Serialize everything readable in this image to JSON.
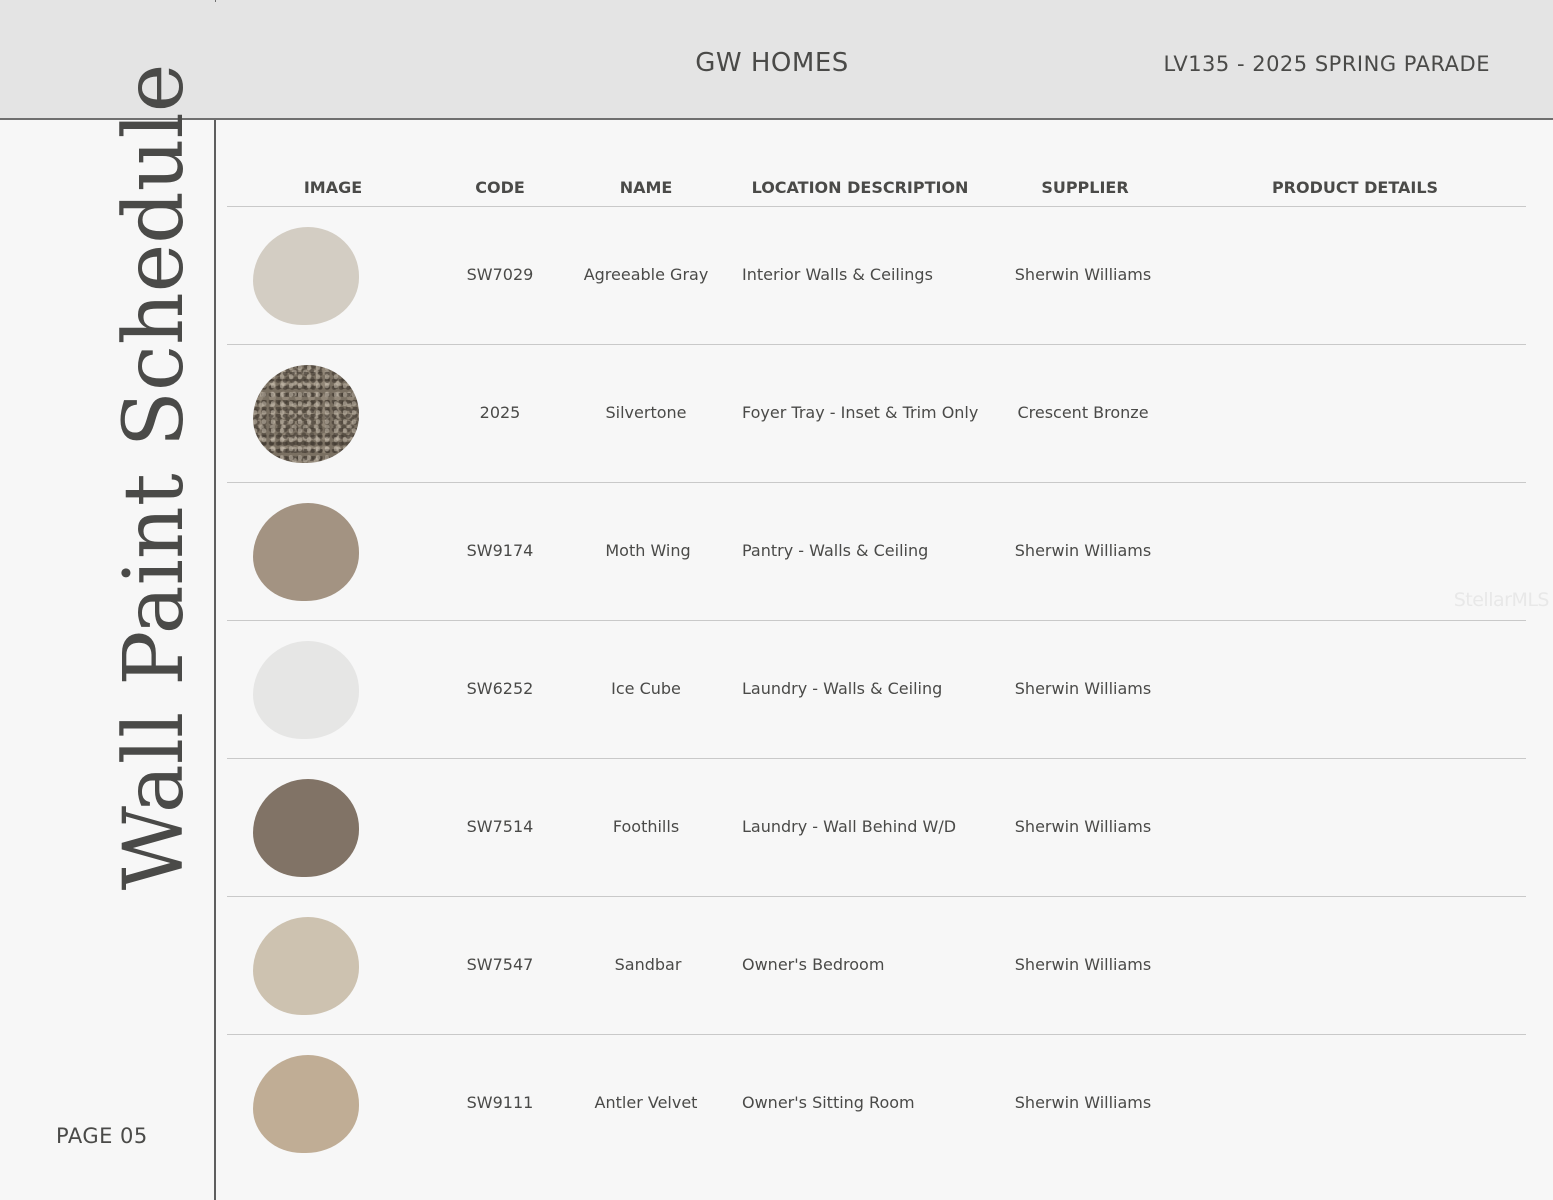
{
  "header": {
    "brand": "GW HOMES",
    "project": "LV135 - 2025 SPRING PARADE"
  },
  "sidebar": {
    "title": "Wall Paint Schedule",
    "page_number": "PAGE 05"
  },
  "watermark": "StellarMLS",
  "table": {
    "columns": [
      "IMAGE",
      "CODE",
      "NAME",
      "LOCATION DESCRIPTION",
      "SUPPLIER",
      "PRODUCT DETAILS"
    ],
    "rows": [
      {
        "swatch_color": "#d3cdc3",
        "code": "SW7029",
        "name": "Agreeable Gray",
        "location": "Interior Walls & Ceilings",
        "supplier": "Sherwin Williams",
        "details": ""
      },
      {
        "swatch_color": "#7a7062",
        "code": "2025",
        "name": "Silvertone",
        "location": "Foyer Tray - Inset & Trim Only",
        "supplier": "Crescent Bronze",
        "details": ""
      },
      {
        "swatch_color": "#a39382",
        "code": "SW9174",
        "name": "Moth Wing",
        "location": "Pantry - Walls & Ceiling",
        "supplier": "Sherwin Williams",
        "details": ""
      },
      {
        "swatch_color": "#e6e6e5",
        "code": "SW6252",
        "name": "Ice Cube",
        "location": "Laundry - Walls & Ceiling",
        "supplier": "Sherwin Williams",
        "details": ""
      },
      {
        "swatch_color": "#817366",
        "code": "SW7514",
        "name": "Foothills",
        "location": "Laundry - Wall Behind W/D",
        "supplier": "Sherwin Williams",
        "details": ""
      },
      {
        "swatch_color": "#cdc2b0",
        "code": "SW7547",
        "name": "Sandbar",
        "location": "Owner's Bedroom",
        "supplier": "Sherwin Williams",
        "details": ""
      },
      {
        "swatch_color": "#c0ad95",
        "code": "SW9111",
        "name": "Antler Velvet",
        "location": "Owner's Sitting Room",
        "supplier": "Sherwin Williams",
        "details": ""
      }
    ]
  }
}
